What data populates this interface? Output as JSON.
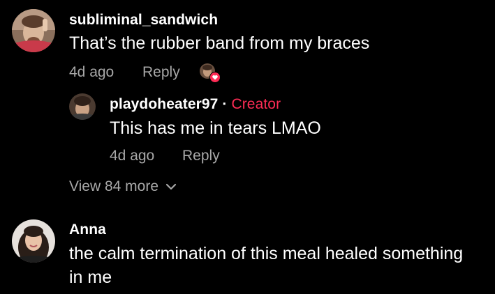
{
  "comments": [
    {
      "username": "subliminal_sandwich",
      "text": "That’s the rubber band from my braces",
      "time": "4d ago",
      "reply_label": "Reply",
      "liked_by_creator": true,
      "replies": [
        {
          "username": "playdoheater97",
          "separator": "·",
          "badge": "Creator",
          "text": "This has me in tears LMAO",
          "time": "4d ago",
          "reply_label": "Reply"
        }
      ],
      "view_more_label": "View 84 more"
    },
    {
      "username": "Anna",
      "text_line1": "the calm termination of this meal healed something",
      "text_line2": "in me"
    }
  ],
  "colors": {
    "background": "#000000",
    "text": "#ffffff",
    "meta": "#a8a8a8",
    "creator_badge": "#fe2c55",
    "like_badge": "#fe2c55"
  },
  "icons": {
    "liked_badge": "heart-icon",
    "view_more": "chevron-down-icon"
  }
}
